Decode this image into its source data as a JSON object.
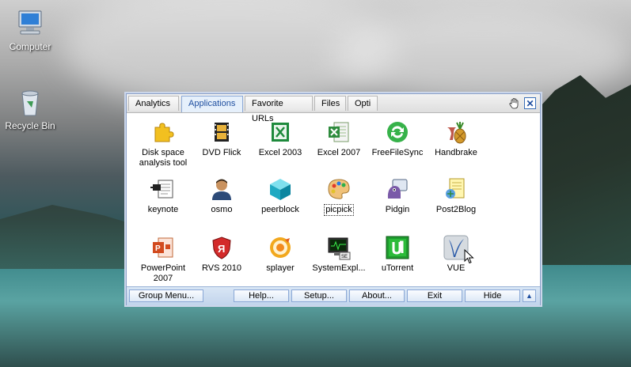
{
  "desktop": {
    "icons": [
      {
        "label": "Computer"
      },
      {
        "label": "Recycle Bin"
      }
    ]
  },
  "window": {
    "tabs": [
      {
        "label": "Analytics"
      },
      {
        "label": "Applications"
      },
      {
        "label": "Favorite URLs"
      },
      {
        "label": "Files"
      },
      {
        "label": "Opti"
      }
    ],
    "active_tab": "Applications",
    "close_glyph": "✕",
    "apps": [
      {
        "label": "Disk space analysis tool",
        "icon": "puzzle-icon"
      },
      {
        "label": "DVD Flick",
        "icon": "film-icon"
      },
      {
        "label": "Excel 2003",
        "icon": "excel-icon"
      },
      {
        "label": "Excel 2007",
        "icon": "excel-icon"
      },
      {
        "label": "FreeFileSync",
        "icon": "sync-icon"
      },
      {
        "label": "Handbrake",
        "icon": "pineapple-icon"
      },
      {
        "label": "keynote",
        "icon": "keynote-icon"
      },
      {
        "label": "osmo",
        "icon": "person-icon"
      },
      {
        "label": "peerblock",
        "icon": "cube-icon"
      },
      {
        "label": "picpick",
        "icon": "palette-icon"
      },
      {
        "label": "Pidgin",
        "icon": "pidgin-icon"
      },
      {
        "label": "Post2Blog",
        "icon": "blog-icon"
      },
      {
        "label": "PowerPoint 2007",
        "icon": "powerpoint-icon"
      },
      {
        "label": "RVS 2010",
        "icon": "shield-icon"
      },
      {
        "label": "splayer",
        "icon": "player-icon"
      },
      {
        "label": "SystemExpl...",
        "icon": "monitor-icon"
      },
      {
        "label": "uTorrent",
        "icon": "utorrent-icon"
      },
      {
        "label": "VUE",
        "icon": "vue-icon"
      }
    ],
    "focused_app": "picpick",
    "bottom": {
      "group_menu": "Group Menu...",
      "help": "Help...",
      "setup": "Setup...",
      "about": "About...",
      "exit": "Exit",
      "hide": "Hide",
      "collapse_glyph": "▲"
    }
  },
  "colors": {
    "accent": "#1f4fa0",
    "bottombar": "#c1d4ec"
  }
}
